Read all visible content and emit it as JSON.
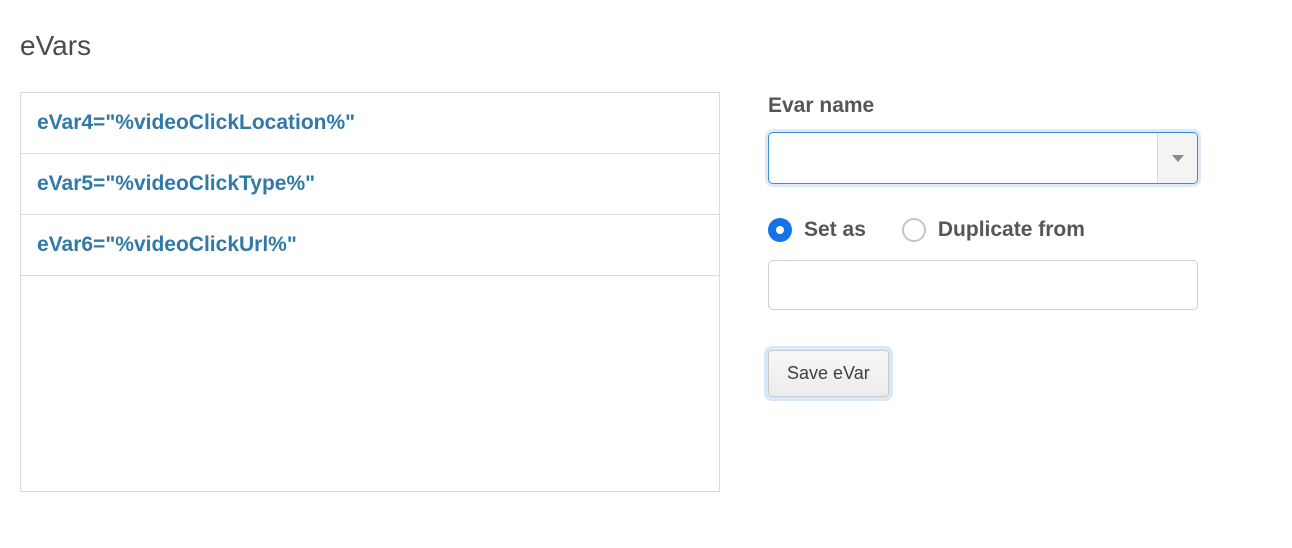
{
  "section": {
    "title": "eVars"
  },
  "evar_list": [
    {
      "display": "eVar4=\"%videoClickLocation%\""
    },
    {
      "display": "eVar5=\"%videoClickType%\""
    },
    {
      "display": "eVar6=\"%videoClickUrl%\""
    }
  ],
  "form": {
    "name_label": "Evar name",
    "dropdown_value": "",
    "radio_setas_label": "Set as",
    "radio_duplicate_label": "Duplicate from",
    "radio_selected": "setas",
    "value_input": "",
    "save_button_label": "Save eVar"
  }
}
